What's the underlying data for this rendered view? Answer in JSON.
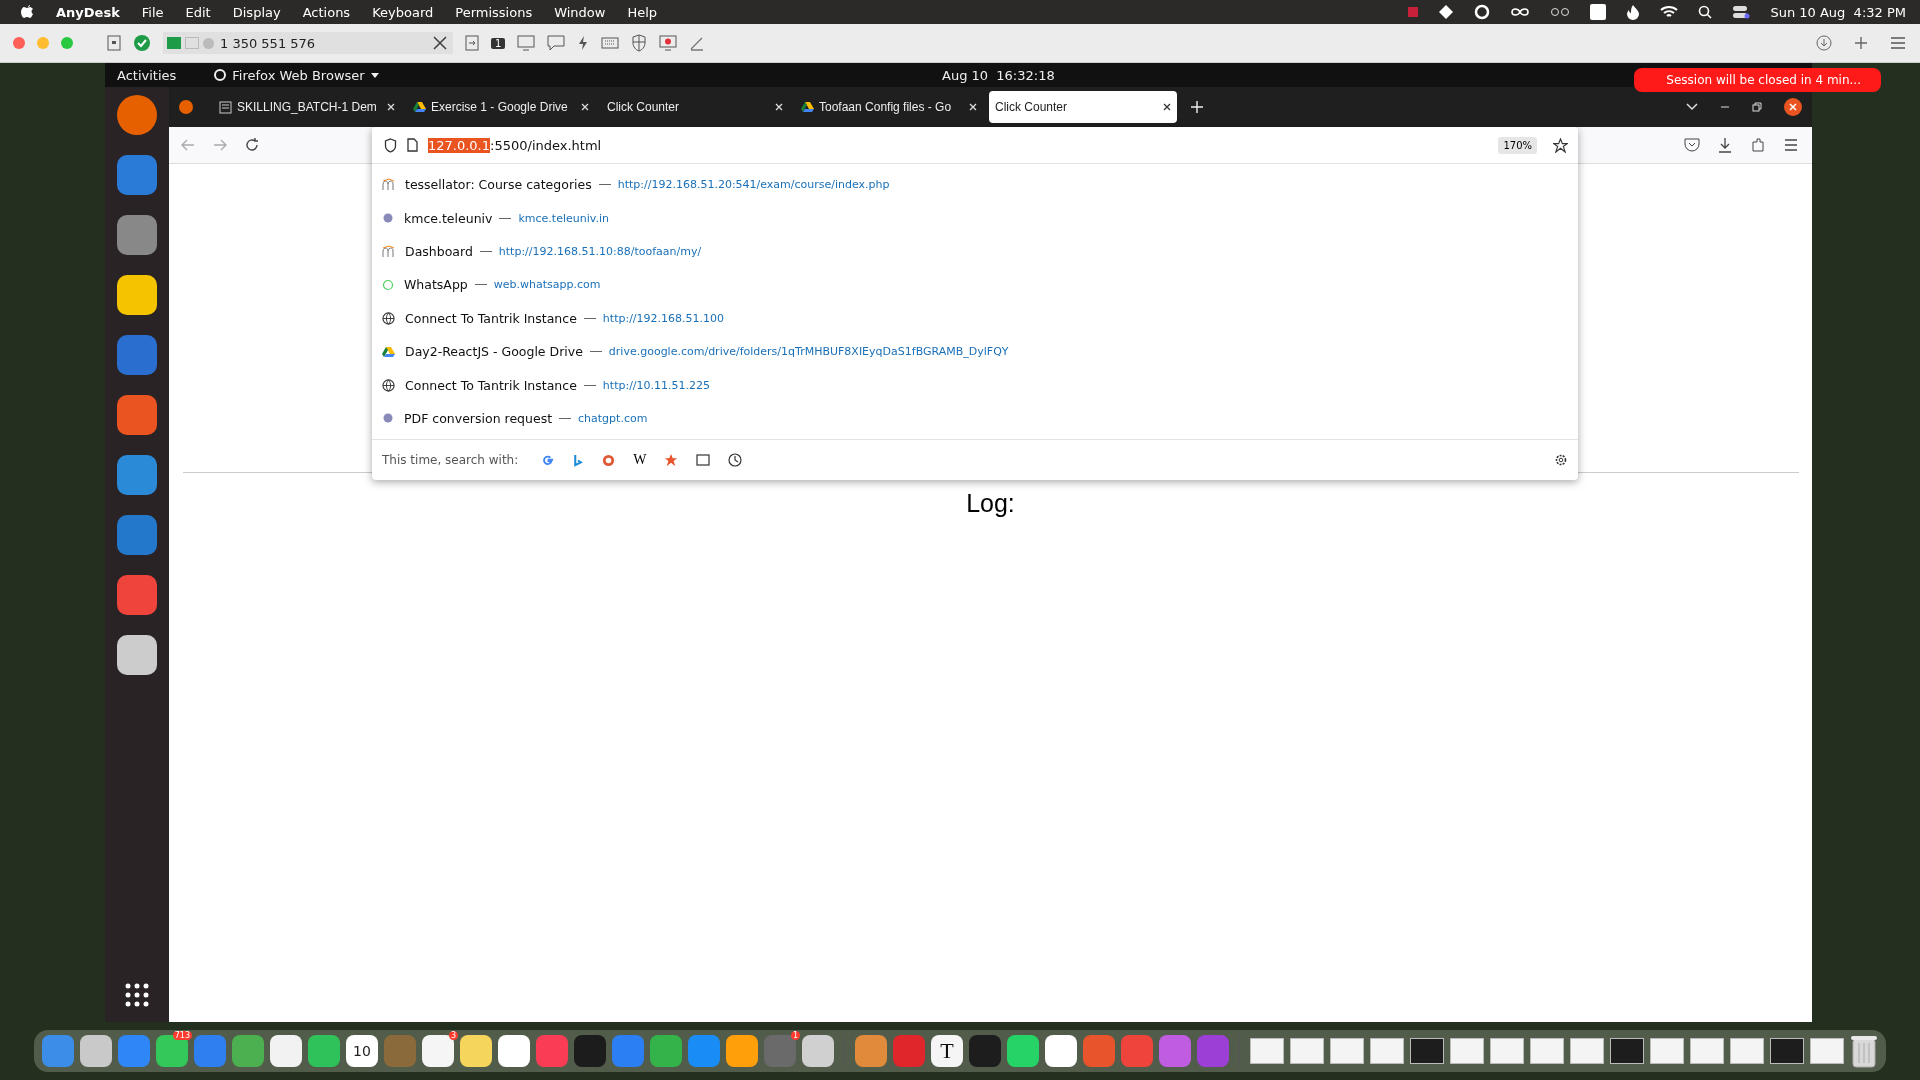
{
  "mac_menu_bar": {
    "app": "AnyDesk",
    "menus": [
      "File",
      "Edit",
      "Display",
      "Actions",
      "Keyboard",
      "Permissions",
      "Window",
      "Help"
    ],
    "clock": "Sun 10 Aug  4:32 PM"
  },
  "anydesk_toolbar": {
    "address": "1 350 551 576",
    "monitor_number": "1"
  },
  "ubuntu_top_bar": {
    "activities": "Activities",
    "app_menu": "Firefox Web Browser",
    "clock": "Aug 10  16:32:18"
  },
  "session_notice": "Session will be closed in 4 min...",
  "browser": {
    "tabs": [
      {
        "title": "SKILLING_BATCH-1 Dem",
        "kind": "doc",
        "selected": false
      },
      {
        "title": "Exercise 1 - Google Drive",
        "kind": "drive",
        "selected": false
      },
      {
        "title": "Click Counter",
        "kind": "plain",
        "selected": false
      },
      {
        "title": "Toofaan Config files - Go",
        "kind": "drive",
        "selected": false
      },
      {
        "title": "Click Counter",
        "kind": "plain",
        "selected": true
      }
    ],
    "url": {
      "highlight": "127.0.0.1",
      "rest": ":5500/index.html"
    },
    "zoom": "170%",
    "suggestions": [
      {
        "title": "tessellator: Course categories",
        "url": "http://192.168.51.20:541/exam/course/index.php",
        "kind": "site"
      },
      {
        "title": "kmce.teleuniv",
        "url": "kmce.teleuniv.in",
        "kind": "dot"
      },
      {
        "title": "Dashboard",
        "url": "http://192.168.51.10:88/toofaan/my/",
        "kind": "site"
      },
      {
        "title": "WhatsApp",
        "url": "web.whatsapp.com",
        "kind": "chat"
      },
      {
        "title": "Connect To Tantrik Instance",
        "url": "http://192.168.51.100",
        "kind": "globe"
      },
      {
        "title": "Day2-ReactJS - Google Drive",
        "url": "drive.google.com/drive/folders/1qTrMHBUF8XIEyqDaS1fBGRAMB_DylFQY",
        "kind": "drive"
      },
      {
        "title": "Connect To Tantrik Instance",
        "url": "http://10.11.51.225",
        "kind": "globe"
      },
      {
        "title": "PDF conversion request",
        "url": "chatgpt.com",
        "kind": "dot"
      }
    ],
    "search_with": "This time, search with:",
    "search_engine_w": "W"
  },
  "page": {
    "log_label": "Log:"
  },
  "dock": {
    "calendar_day": "10",
    "messages_badge": "713",
    "reminders_badge": "3",
    "settings_badge": "1",
    "text_app_letter": "T"
  }
}
